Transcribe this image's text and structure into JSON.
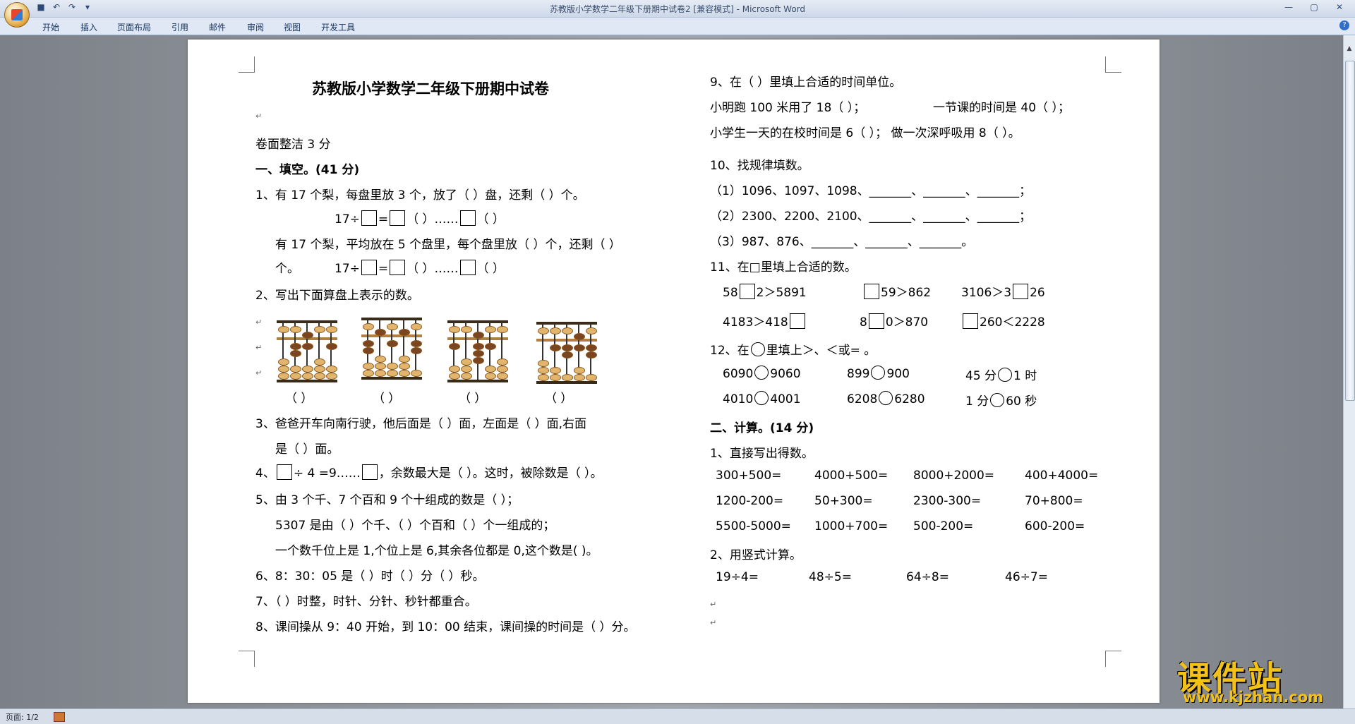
{
  "window": {
    "title": "苏教版小学数学二年级下册期中试卷2 [兼容模式] - Microsoft Word",
    "controls": [
      "—",
      "▢",
      "✕"
    ]
  },
  "ribbon": {
    "tabs": [
      "开始",
      "插入",
      "页面布局",
      "引用",
      "邮件",
      "审阅",
      "视图",
      "开发工具"
    ],
    "help": "?"
  },
  "status": {
    "page": "页面: 1/2"
  },
  "watermark": {
    "main": "课件站",
    "url": "www.kjzhan.com"
  },
  "doc": {
    "title": "苏教版小学数学二年级下册期中试卷",
    "neat": "卷面整洁 3 分",
    "sec1": "一、填空。(41 分)",
    "q1": "1、有 17 个梨，每盘里放 3 个，放了（  ）盘，还剩（  ）个。",
    "q1_eq_prefix": "17÷",
    "q1_eq_mid": "=",
    "q1_eq_tail": "（  ）……",
    "q1_eq_end": "（  ）",
    "q1b": "有 17 个梨，平均放在 5 个盘里，每个盘里放（  ）个，还剩（  ）",
    "q1b_cont": "个。",
    "q2": "2、写出下面算盘上表示的数。",
    "q2_answers": [
      "（    ）",
      "（    ）",
      "（    ）",
      "（    ）"
    ],
    "q3a": "3、爸爸开车向南行驶，他后面是（     ）面，左面是（     ）面,右面",
    "q3b": "是（     ）面。",
    "q4_prefix": "4、",
    "q4_mid": "÷  4  =9……",
    "q4_tail": "，余数最大是（  ）。这时，被除数是（    ）。",
    "q5a": "5、由 3 个千、7 个百和 9 个十组成的数是（       ）；",
    "q5b": "5307 是由（  ）个千、（    ）个百和（    ）个一组成的；",
    "q5c": "一个数千位上是 1,个位上是 6,其余各位都是 0,这个数是(      )。",
    "q6": "6、8：30：05 是（     ）时（    ）分（    ）秒。",
    "q7": "7、（  ）时整，时针、分针、秒针都重合。",
    "q8": "8、课间操从 9：40 开始，到 10：00 结束，课间操的时间是（    ）分。",
    "q9": "9、在（  ）里填上合适的时间单位。",
    "q9a": "小明跑 100 米用了 18（       ）；",
    "q9b": "一节课的时间是 40（      ）；",
    "q9c": "小学生一天的在校时间是 6（      ）；  做一次深呼吸用 8（    ）。",
    "q10": "10、找规律填数。",
    "q10a": "（1）1096、1097、1098、_______、_______、_______；",
    "q10b": "（2）2300、2200、2100、_______、_______、_______；",
    "q10c": "（3）987、876、_______、_______、_______。",
    "q11": "11、在□里填上合适的数。",
    "q11_items": [
      {
        "a": "58",
        "b": "2＞5891"
      },
      {
        "a": "",
        "b": "59＞862"
      },
      {
        "a": "3106＞3",
        "b": "26"
      },
      {
        "a": "4183＞418",
        "b": ""
      },
      {
        "a": "8",
        "b": "0＞870"
      },
      {
        "a": "",
        "b": "260＜2228"
      }
    ],
    "q12": "12、在",
    "q12_tail": "里填上＞、＜或= 。",
    "q12_items": [
      {
        "a": "6090",
        "b": "9060"
      },
      {
        "a": "899",
        "b": "900"
      },
      {
        "a": "45 分",
        "b": "1 时"
      },
      {
        "a": "4010",
        "b": "4001"
      },
      {
        "a": "6208",
        "b": "6280"
      },
      {
        "a": "1 分",
        "b": "60 秒"
      }
    ],
    "sec2": "二、计算。(14 分)",
    "c1": "1、直接写出得数。",
    "c1_rows": [
      [
        "300+500=",
        "4000+500=",
        "8000+2000=",
        "400+4000="
      ],
      [
        "1200-200=",
        "50+300=",
        "2300-300=",
        "70+800="
      ],
      [
        "5500-5000=",
        "1000+700=",
        "500-200=",
        "600-200="
      ]
    ],
    "c2": "2、用竖式计算。",
    "c2_items": [
      "19÷4=",
      "48÷5=",
      "64÷8=",
      "46÷7="
    ]
  }
}
